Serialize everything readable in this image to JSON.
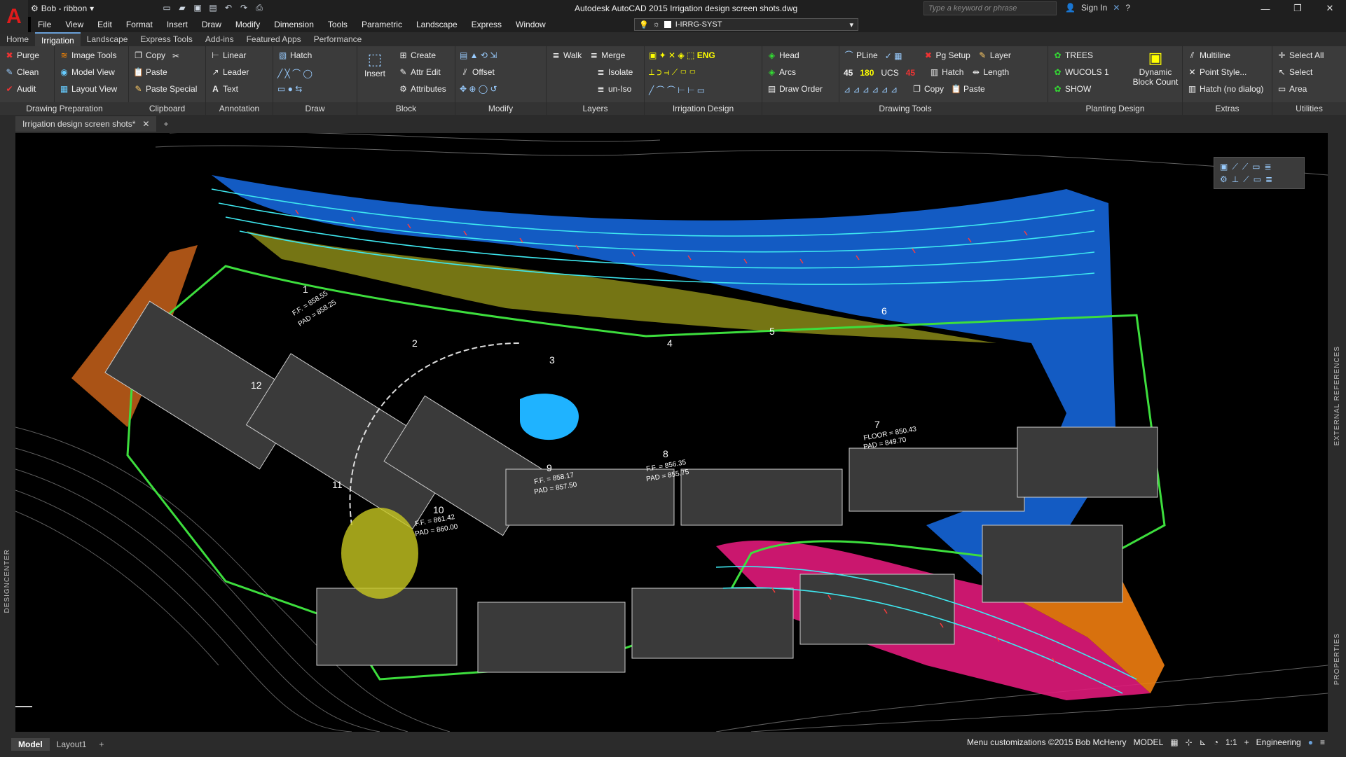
{
  "workspace": {
    "name": "Bob - ribbon"
  },
  "window": {
    "title": "Autodesk AutoCAD 2015    Irrigation design screen shots.dwg"
  },
  "search": {
    "placeholder": "Type a keyword or phrase"
  },
  "account": {
    "signin": "Sign In"
  },
  "menu": [
    "File",
    "View",
    "Edit",
    "Format",
    "Insert",
    "Draw",
    "Modify",
    "Dimension",
    "Tools",
    "Parametric",
    "Landscape",
    "Express",
    "Window"
  ],
  "layer": {
    "current": "I-IRRG-SYST"
  },
  "ribbon_tabs": [
    "Home",
    "Irrigation",
    "Landscape",
    "Express Tools",
    "Add-ins",
    "Featured Apps",
    "Performance"
  ],
  "active_tab": "Irrigation",
  "panels": {
    "drawing_prep": {
      "title": "Drawing Preparation",
      "items": [
        "Purge",
        "Clean",
        "Audit"
      ]
    },
    "image_tools": {
      "items": [
        "Image Tools",
        "Model View",
        "Layout View"
      ]
    },
    "clipboard": {
      "title": "Clipboard",
      "items": [
        "Copy",
        "Paste",
        "Paste Special"
      ]
    },
    "annotation": {
      "title": "Annotation",
      "items": [
        "Linear",
        "Leader",
        "Text"
      ]
    },
    "draw": {
      "title": "Draw",
      "items": [
        "Hatch"
      ]
    },
    "block": {
      "title": "Block",
      "items": [
        "Insert",
        "Create",
        "Attr Edit",
        "Attributes"
      ]
    },
    "modify": {
      "title": "Modify",
      "items": [
        "Offset"
      ]
    },
    "layers": {
      "title": "Layers",
      "items": [
        "Walk",
        "Merge",
        "Isolate",
        "un-Iso"
      ]
    },
    "irrigation_design": {
      "title": "Irrigation Design"
    },
    "head": {
      "items": [
        "Head",
        "Arcs",
        "Draw Order"
      ]
    },
    "drawing_tools": {
      "title": "Drawing Tools",
      "items": [
        "PLine",
        "UCS",
        "Pg Setup",
        "Layer",
        "Hatch",
        "Length",
        "Copy",
        "Paste"
      ],
      "ucs_labels": [
        "45",
        "180",
        "45"
      ]
    },
    "planting": {
      "title": "Planting Design",
      "items": [
        "TREES",
        "WUCOLS 1",
        "SHOW",
        "Dynamic Block Count"
      ]
    },
    "extras": {
      "title": "Extras",
      "items": [
        "Multiline",
        "Point Style...",
        "Hatch (no dialog)"
      ]
    },
    "utilities": {
      "title": "Utilities",
      "items": [
        "Select All",
        "Select",
        "Area"
      ]
    }
  },
  "document": {
    "tab": "Irrigation design screen shots*"
  },
  "drawing_labels": {
    "buildings": [
      "1",
      "2",
      "3",
      "4",
      "5",
      "6",
      "7",
      "8",
      "9",
      "10",
      "11",
      "12"
    ],
    "elevations": [
      "F.F. = 858.55",
      "PAD = 858.25",
      "F.F. = 858.17",
      "PAD = 857.50",
      "F.F. = 856.35",
      "PAD = 855.75",
      "FLOOR = 850.43",
      "PAD = 849.70",
      "F.F. = 861.42",
      "PAD = 860.00"
    ]
  },
  "side_panels": {
    "left": "DESIGNCENTER",
    "right_top": "EXTERNAL REFERENCES",
    "right_bottom": "PROPERTIES"
  },
  "layouts": [
    "Model",
    "Layout1"
  ],
  "status": {
    "copyright": "Menu customizations ©2015 Bob McHenry",
    "space": "MODEL",
    "scale": "1:1",
    "units": "Engineering"
  },
  "colors": {
    "bg": "#000000",
    "ribbon": "#3b3b3b",
    "blue_zone": "#1565d8",
    "magenta_zone": "#e0197a",
    "orange_zone": "#f07d10",
    "olive_zone": "#8a8a18",
    "cyan_pipe": "#3ee8f0",
    "building": "#3a3a3a",
    "accent_red": "#e01b1b"
  }
}
